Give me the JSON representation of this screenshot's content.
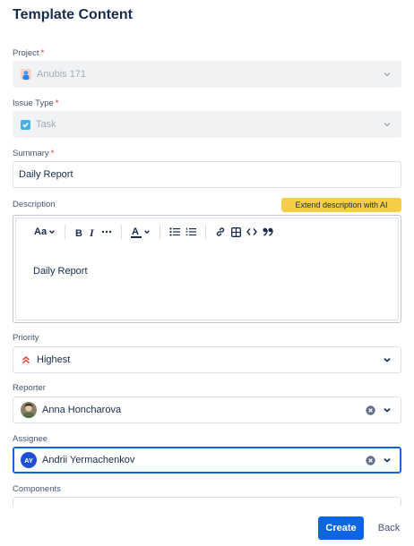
{
  "page": {
    "title": "Template Content"
  },
  "fields": {
    "project": {
      "label": "Project",
      "required_mark": "*",
      "value": "Anubis 171"
    },
    "issue_type": {
      "label": "Issue Type",
      "required_mark": "*",
      "value": "Task"
    },
    "summary": {
      "label": "Summary",
      "required_mark": "*",
      "value": "Daily Report"
    },
    "description": {
      "label": "Description",
      "ai_button": "Extend description with AI",
      "text_style": "Aa",
      "value": "Daily Report"
    },
    "priority": {
      "label": "Priority",
      "value": "Highest"
    },
    "reporter": {
      "label": "Reporter",
      "value": "Anna Honcharova"
    },
    "assignee": {
      "label": "Assignee",
      "value": "Andrii Yermachenkov",
      "initials": "AY"
    },
    "components": {
      "label": "Components"
    }
  },
  "actions": {
    "create": "Create",
    "back": "Back"
  },
  "colors": {
    "primary": "#0c66e4",
    "ai_button": "#f5cd47",
    "priority_highest": "#e2483d",
    "required": "#c9372c"
  }
}
